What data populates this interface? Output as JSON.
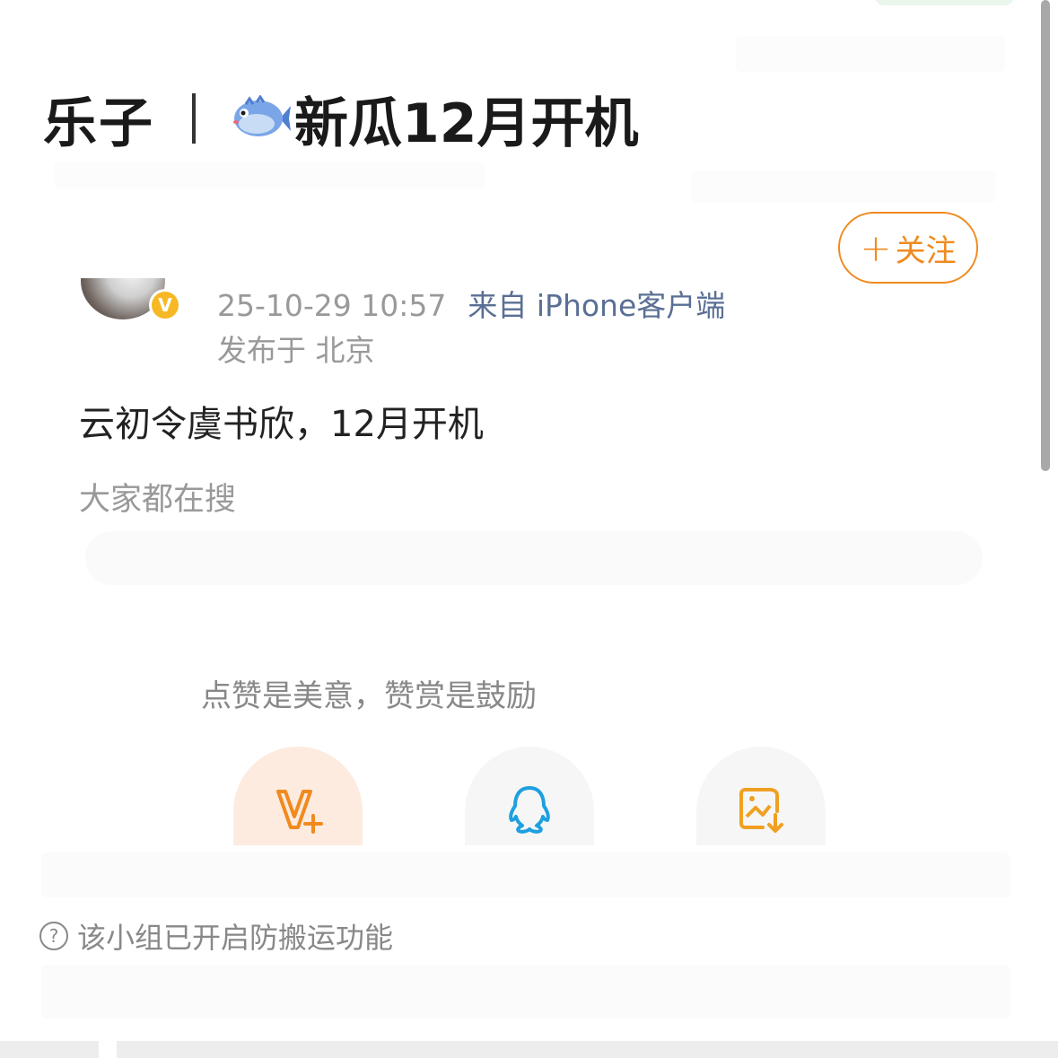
{
  "header": {
    "group_name_part1": "乐子",
    "fish_icon": "blowfish-emoji",
    "group_name_part2": "新瓜12月开机"
  },
  "follow_button": {
    "plus": "+",
    "label": "关注",
    "color": "#f08a1f"
  },
  "post": {
    "time": "25-10-29 10:57",
    "source": "来自 iPhone客户端",
    "location": "发布于 北京",
    "badge": "V",
    "text": "云初令虞书欣，12月开机",
    "search_label": "大家都在搜"
  },
  "share_sheet": {
    "hint": "点赞是美意，赞赏是鼓励",
    "items": [
      {
        "icon": "vplus-icon",
        "color": "#f08a1f"
      },
      {
        "icon": "qq-icon",
        "color": "#1ea0e0"
      },
      {
        "icon": "save-image-icon",
        "color": "#f0a020"
      }
    ]
  },
  "notice": {
    "icon": "help-circle-icon",
    "text": "该小组已开启防搬运功能"
  }
}
